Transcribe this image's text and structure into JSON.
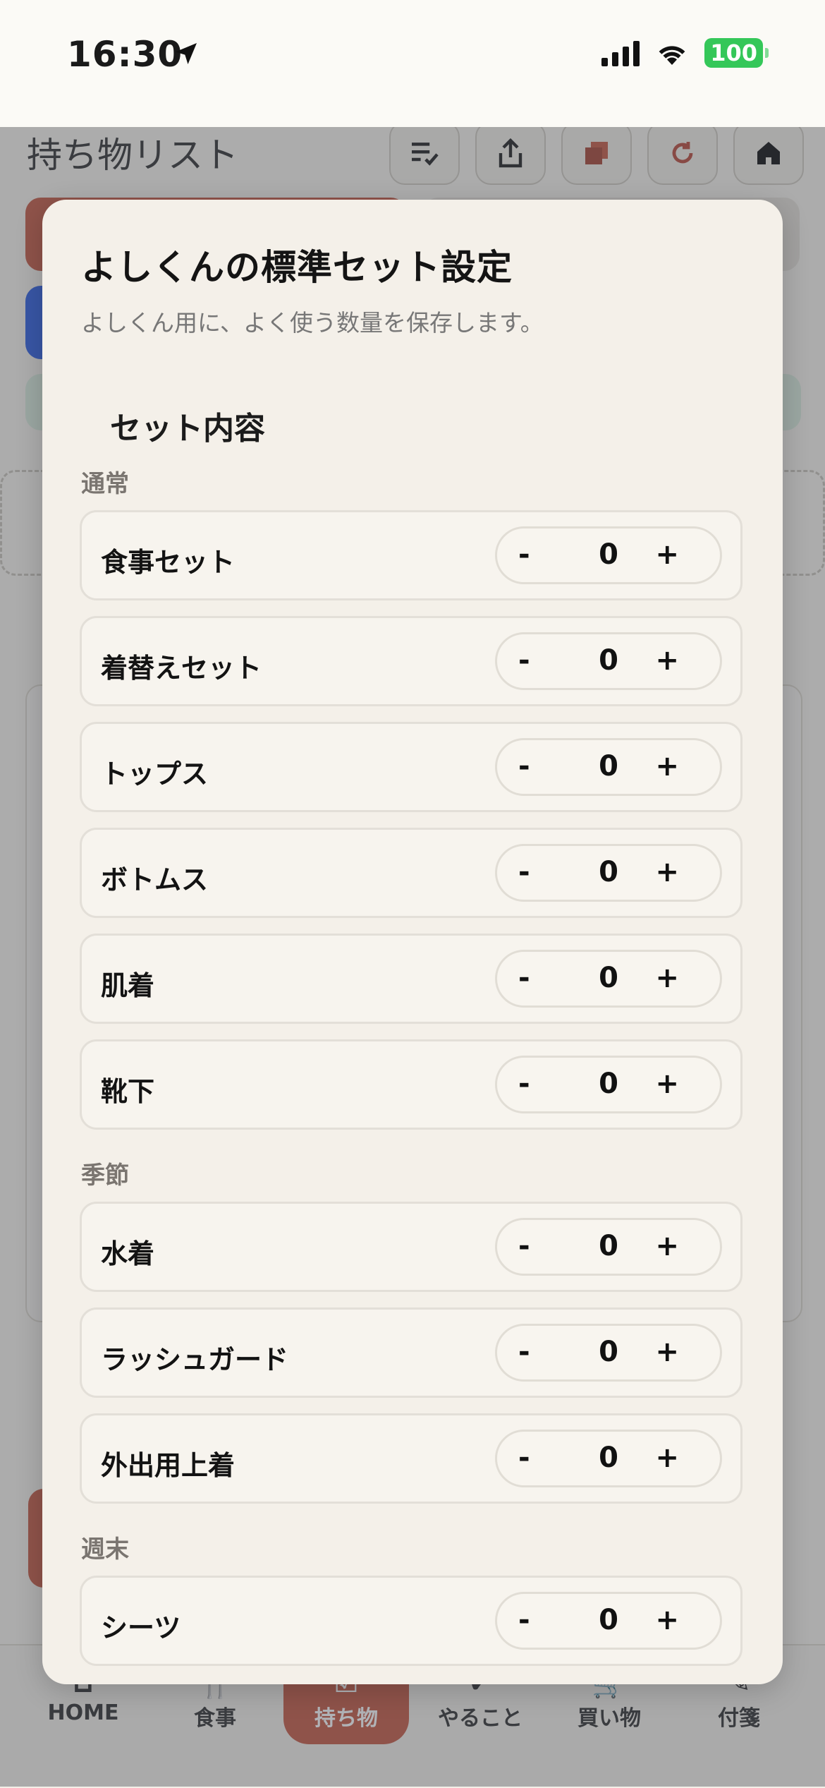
{
  "status_bar": {
    "time": "16:30",
    "battery": "100"
  },
  "background": {
    "title": "持ち物リスト",
    "nav": [
      {
        "label": "HOME",
        "icon": "home-icon"
      },
      {
        "label": "食事",
        "icon": "fork-knife-icon"
      },
      {
        "label": "持ち物",
        "icon": "checklist-icon",
        "active": true
      },
      {
        "label": "やること",
        "icon": "check-circle-icon"
      },
      {
        "label": "買い物",
        "icon": "cart-icon"
      },
      {
        "label": "付箋",
        "icon": "note-icon"
      }
    ]
  },
  "modal": {
    "title": "よしくんの標準セット設定",
    "subtitle": "よしくん用に、よく使う数量を保存します。",
    "section_title": "セット内容",
    "groups": [
      {
        "label": "通常"
      },
      {
        "label": "季節"
      },
      {
        "label": "週末"
      }
    ],
    "items": [
      {
        "label": "食事セット",
        "qty": "0"
      },
      {
        "label": "着替えセット",
        "qty": "0"
      },
      {
        "label": "トップス",
        "qty": "0"
      },
      {
        "label": "ボトムス",
        "qty": "0"
      },
      {
        "label": "肌着",
        "qty": "0"
      },
      {
        "label": "靴下",
        "qty": "0"
      },
      {
        "label": "水着",
        "qty": "0"
      },
      {
        "label": "ラッシュガード",
        "qty": "0"
      },
      {
        "label": "外出用上着",
        "qty": "0"
      },
      {
        "label": "シーツ",
        "qty": "0"
      }
    ],
    "minus_label": "-",
    "plus_label": "+"
  },
  "colors": {
    "accent": "#c55a44",
    "modal_bg": "#f4f0e9"
  }
}
